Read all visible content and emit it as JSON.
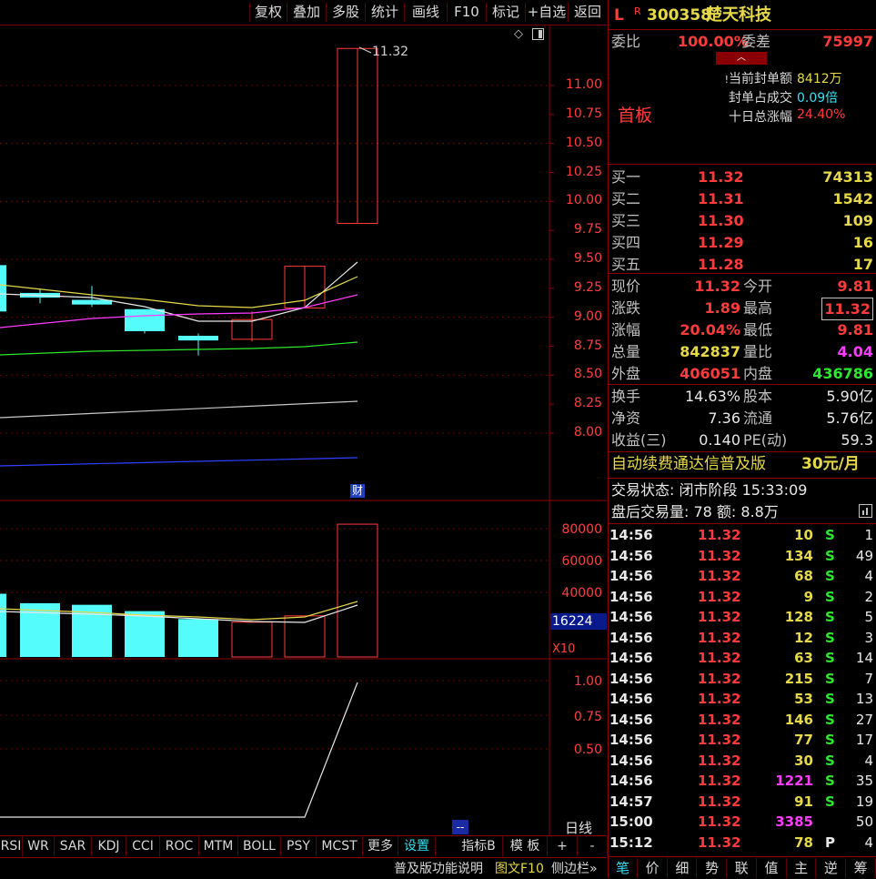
{
  "toolbar": {
    "items": [
      "复权",
      "叠加",
      "多股",
      "统计",
      "画线",
      "F10",
      "标记",
      "+自选",
      "返回"
    ]
  },
  "chart": {
    "high_label": "11.32",
    "price_axis": [
      "11.00",
      "10.75",
      "10.50",
      "10.25",
      "10.00",
      "9.75",
      "9.50",
      "9.25",
      "9.00",
      "8.75",
      "8.50",
      "8.25",
      "8.00"
    ],
    "cai_label": "财",
    "vol_axis": [
      "80000",
      "60000",
      "40000"
    ],
    "vol_current": "16224",
    "vol_unit": "X10",
    "ind_axis": [
      "1.00",
      "0.75",
      "0.50"
    ]
  },
  "chart_data": {
    "type": "candlestick",
    "candles": [
      {
        "open": 9.45,
        "close": 9.05,
        "high": 9.45,
        "low": 9.05,
        "up": false
      },
      {
        "open": 9.21,
        "close": 9.17,
        "high": 9.25,
        "low": 9.12,
        "up": false
      },
      {
        "open": 9.15,
        "close": 9.11,
        "high": 9.27,
        "low": 9.09,
        "up": false
      },
      {
        "open": 9.07,
        "close": 8.88,
        "high": 9.07,
        "low": 8.86,
        "up": false
      },
      {
        "open": 8.84,
        "close": 8.8,
        "high": 8.86,
        "low": 8.67,
        "up": false
      },
      {
        "open": 8.81,
        "close": 8.98,
        "high": 9.05,
        "low": 8.79,
        "up": true
      },
      {
        "open": 9.08,
        "close": 9.44,
        "high": 9.44,
        "low": 9.08,
        "up": true
      },
      {
        "open": 9.81,
        "close": 11.32,
        "high": 11.32,
        "low": 9.81,
        "up": true
      }
    ],
    "volumes": [
      40000,
      34000,
      33000,
      29000,
      24000,
      22000,
      26000,
      84000
    ],
    "volume_up": [
      false,
      false,
      false,
      false,
      false,
      true,
      true,
      true
    ]
  },
  "quote": {
    "code": "300358",
    "name": "楚天科技",
    "weibi_label": "委比",
    "weibi": "100.00%",
    "weicha_label": "委差",
    "weicha": "75997",
    "board": "首板",
    "seal_label": "当前封单额",
    "seal_val": "8412万",
    "ratio_label": "封单占成交",
    "ratio_val": "0.09倍",
    "tenday_label": "十日总涨幅",
    "tenday_val": "24.40%",
    "bids": [
      {
        "label": "买一",
        "price": "11.32",
        "vol": "74313"
      },
      {
        "label": "买二",
        "price": "11.31",
        "vol": "1542"
      },
      {
        "label": "买三",
        "price": "11.30",
        "vol": "109"
      },
      {
        "label": "买四",
        "price": "11.29",
        "vol": "16"
      },
      {
        "label": "买五",
        "price": "11.28",
        "vol": "17"
      }
    ],
    "stats": [
      {
        "l1": "现价",
        "v1": "11.32",
        "l2": "今开",
        "v2": "9.81"
      },
      {
        "l1": "涨跌",
        "v1": "1.89",
        "l2": "最高",
        "v2": "11.32"
      },
      {
        "l1": "涨幅",
        "v1": "20.04%",
        "l2": "最低",
        "v2": "9.81"
      },
      {
        "l1": "总量",
        "v1": "842837",
        "l2": "量比",
        "v2": "4.04"
      },
      {
        "l1": "外盘",
        "v1": "406051",
        "l2": "内盘",
        "v2": "436786"
      }
    ],
    "fin": [
      {
        "l1": "换手",
        "v1": "14.63%",
        "l2": "股本",
        "v2": "5.90亿"
      },
      {
        "l1": "净资",
        "v1": "7.36",
        "l2": "流通",
        "v2": "5.76亿"
      },
      {
        "l1": "收益(三)",
        "v1": "0.140",
        "l2": "PE(动)",
        "v2": "59.3"
      }
    ],
    "promo": "自动续费通达信普及版",
    "promo_price": "30元/月",
    "status": "交易状态: 闭市阶段 15:33:09",
    "after": "盘后交易量: 78  额: 8.8万"
  },
  "ticks": [
    {
      "t": "14:56",
      "p": "11.32",
      "v": "10",
      "s": "S",
      "n": "1"
    },
    {
      "t": "14:56",
      "p": "11.32",
      "v": "134",
      "s": "S",
      "n": "49"
    },
    {
      "t": "14:56",
      "p": "11.32",
      "v": "68",
      "s": "S",
      "n": "4"
    },
    {
      "t": "14:56",
      "p": "11.32",
      "v": "9",
      "s": "S",
      "n": "2"
    },
    {
      "t": "14:56",
      "p": "11.32",
      "v": "128",
      "s": "S",
      "n": "5"
    },
    {
      "t": "14:56",
      "p": "11.32",
      "v": "12",
      "s": "S",
      "n": "3"
    },
    {
      "t": "14:56",
      "p": "11.32",
      "v": "63",
      "s": "S",
      "n": "14"
    },
    {
      "t": "14:56",
      "p": "11.32",
      "v": "215",
      "s": "S",
      "n": "7"
    },
    {
      "t": "14:56",
      "p": "11.32",
      "v": "53",
      "s": "S",
      "n": "13"
    },
    {
      "t": "14:56",
      "p": "11.32",
      "v": "146",
      "s": "S",
      "n": "27"
    },
    {
      "t": "14:56",
      "p": "11.32",
      "v": "77",
      "s": "S",
      "n": "17"
    },
    {
      "t": "14:56",
      "p": "11.32",
      "v": "30",
      "s": "S",
      "n": "4"
    },
    {
      "t": "14:56",
      "p": "11.32",
      "v": "1221",
      "s": "S",
      "n": "35"
    },
    {
      "t": "14:57",
      "p": "11.32",
      "v": "91",
      "s": "S",
      "n": "19"
    },
    {
      "t": "15:00",
      "p": "11.32",
      "v": "3385",
      "s": "",
      "n": "50"
    },
    {
      "t": "15:12",
      "p": "11.32",
      "v": "78",
      "s": "P",
      "n": "4"
    }
  ],
  "indicator_tabs": [
    "RSI",
    "WR",
    "SAR",
    "KDJ",
    "CCI",
    "ROC",
    "MTM",
    "BOLL",
    "PSY",
    "MCST",
    "更多",
    "设置"
  ],
  "indicator_right": [
    "指标B",
    "模 板",
    "+",
    "-",
    "日线"
  ],
  "bottom_bar": [
    "普及版功能说明",
    "图文F10",
    "侧边栏»"
  ],
  "right_tabs": [
    "笔",
    "价",
    "细",
    "势",
    "联",
    "值",
    "主",
    "逆",
    "筹"
  ]
}
